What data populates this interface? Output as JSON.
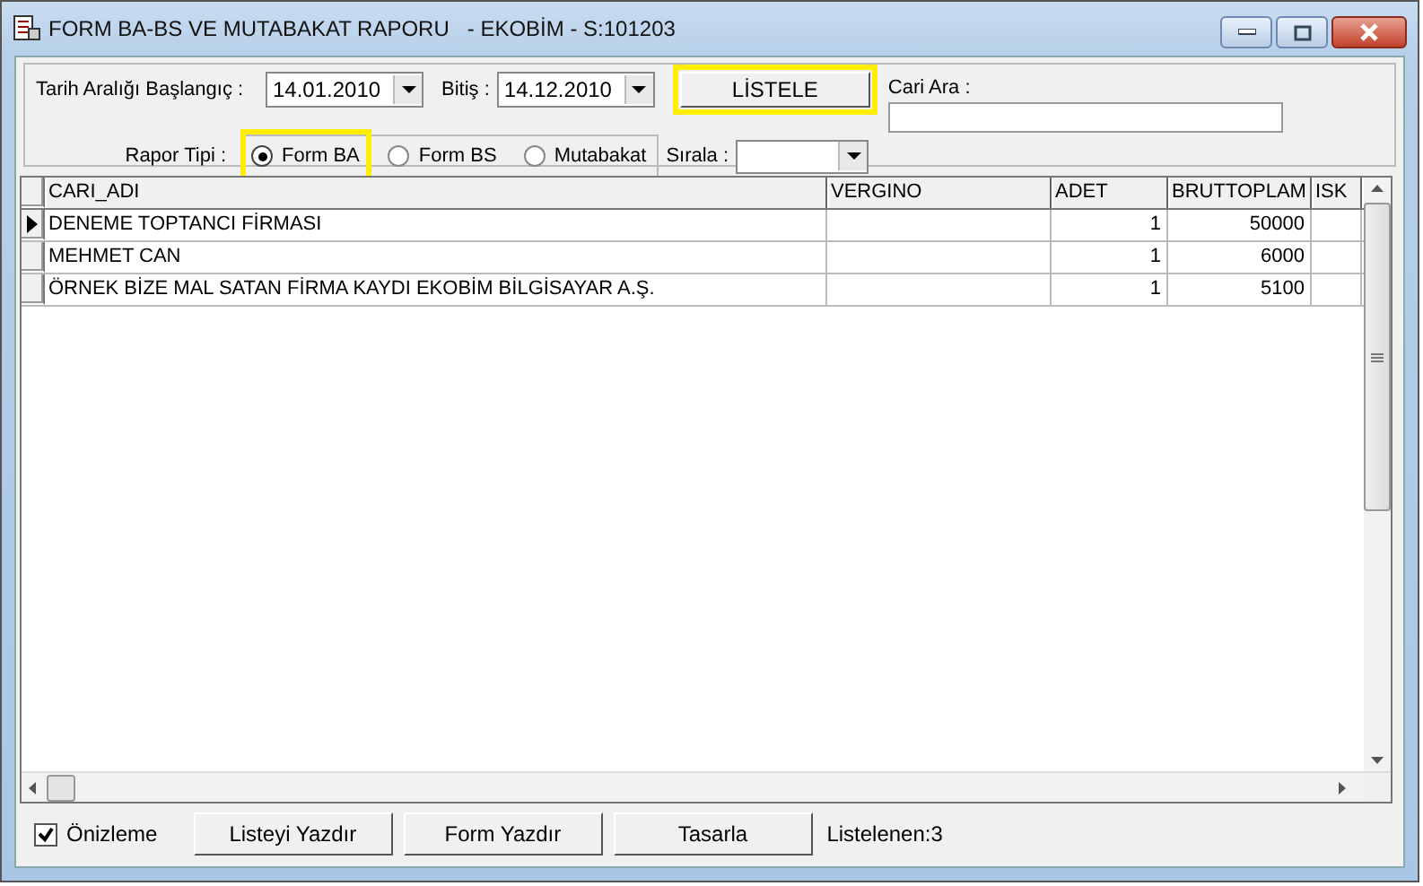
{
  "window": {
    "title": "FORM BA-BS VE MUTABAKAT RAPORU   - EKOBİM - S:101203"
  },
  "filters": {
    "start_label": "Tarih Aralığı Başlangıç :",
    "start_value": "14.01.2010",
    "end_label": "Bitiş :",
    "end_value": "14.12.2010",
    "list_button": "LİSTELE",
    "search_label": "Cari Ara :",
    "type_label": "Rapor Tipi :",
    "sort_label": "Sırala :",
    "report_types": [
      {
        "label": "Form BA",
        "selected": true
      },
      {
        "label": "Form BS",
        "selected": false
      },
      {
        "label": "Mutabakat",
        "selected": false
      }
    ]
  },
  "table": {
    "columns": [
      "CARI_ADI",
      "VERGINO",
      "ADET",
      "BRUTTOPLAM",
      "ISK"
    ],
    "rows": [
      {
        "selected": true,
        "cells": [
          "DENEME TOPTANCI FİRMASI",
          "",
          "1",
          "50000",
          ""
        ]
      },
      {
        "selected": false,
        "cells": [
          "MEHMET CAN",
          "",
          "1",
          "6000",
          ""
        ]
      },
      {
        "selected": false,
        "cells": [
          "ÖRNEK BİZE MAL SATAN FİRMA KAYDI EKOBİM BİLGİSAYAR A.Ş.",
          "",
          "1",
          "5100",
          ""
        ]
      }
    ]
  },
  "footer": {
    "preview": {
      "label": "Önizleme",
      "checked": true
    },
    "buttons": [
      "Listeyi Yazdır",
      "Form Yazdır",
      "Tasarla"
    ],
    "count": "Listelenen:3"
  }
}
